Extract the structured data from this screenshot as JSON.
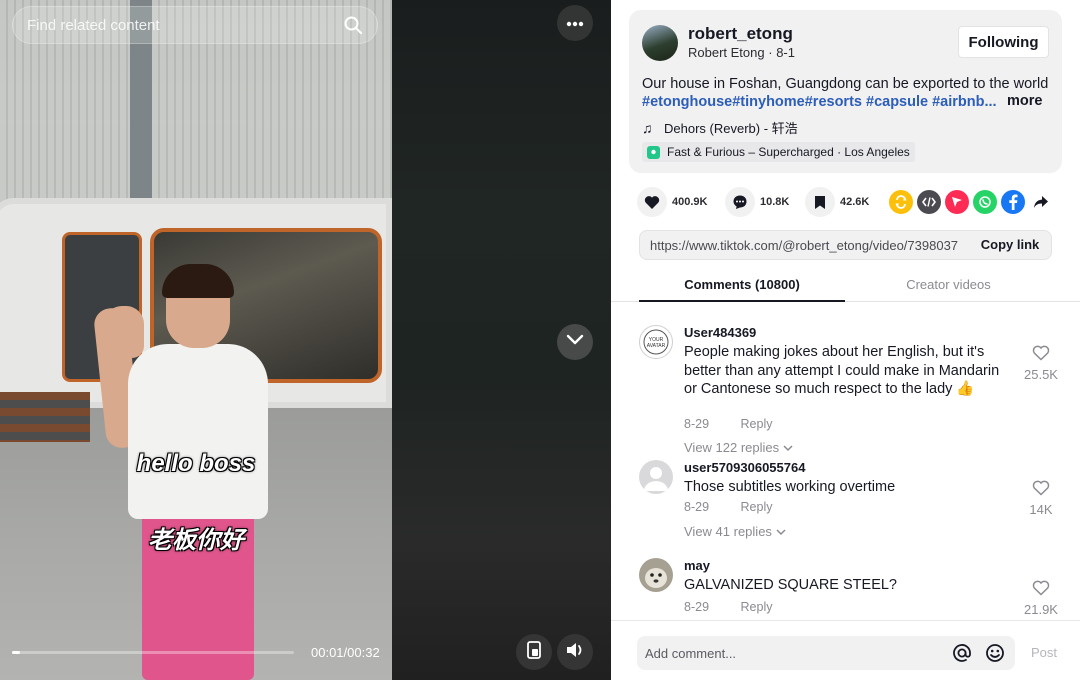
{
  "video": {
    "search_placeholder": "Find related content",
    "caption_en": "hello boss",
    "caption_zh": "老板你好",
    "time_display": "00:01/00:32",
    "progress_fraction": 0.03,
    "icons": {
      "search": "search-icon",
      "more": "ellipsis-icon",
      "next": "chevron-down-icon",
      "pip": "picture-in-picture-icon",
      "volume": "volume-icon"
    }
  },
  "post": {
    "author_username": "robert_etong",
    "author_display": "Robert Etong",
    "date": "8-1",
    "follow_label": "Following",
    "description": "Our house in Foshan, Guangdong can be exported to the world",
    "hashtags": "#etonghouse#tinyhome#resorts #capsule #airbnb...",
    "more_label": "more",
    "music": "Dehors (Reverb) - 轩浩",
    "location": "Fast & Furious – Supercharged · Los Angeles"
  },
  "actions": {
    "likes": "400.9K",
    "comments": "10.8K",
    "saves": "42.6K",
    "share_targets": [
      "repost-icon",
      "embed-icon",
      "send-icon",
      "whatsapp-icon",
      "facebook-icon",
      "share-arrow-icon"
    ]
  },
  "link": {
    "url": "https://www.tiktok.com/@robert_etong/video/7398037",
    "copy_label": "Copy link"
  },
  "tabs": {
    "comments_label": "Comments (10800)",
    "creator_label": "Creator videos"
  },
  "comments": [
    {
      "user": "User484369",
      "text": "People making jokes about her English, but it's better than any attempt I could make in Mandarin or Cantonese so much respect to the lady 👍",
      "date": "8-29",
      "reply_label": "Reply",
      "likes": "25.5K",
      "view_replies": "View 122 replies"
    },
    {
      "user": "user5709306055764",
      "text": "Those subtitles working overtime",
      "date": "8-29",
      "reply_label": "Reply",
      "likes": "14K",
      "view_replies": "View 41 replies"
    },
    {
      "user": "may",
      "text": "GALVANIZED SQUARE STEEL?",
      "date": "8-29",
      "reply_label": "Reply",
      "likes": "21.9K"
    }
  ],
  "comment_bar": {
    "placeholder": "Add comment...",
    "post_label": "Post"
  },
  "colors": {
    "hashtag": "#2b5db9",
    "text_primary": "#161823",
    "text_secondary": "#8a8b91",
    "card_bg": "#f1f1f2",
    "repost": "#fcc00a",
    "send": "#fe2c55",
    "whatsapp": "#25d366",
    "facebook": "#1877f2"
  }
}
